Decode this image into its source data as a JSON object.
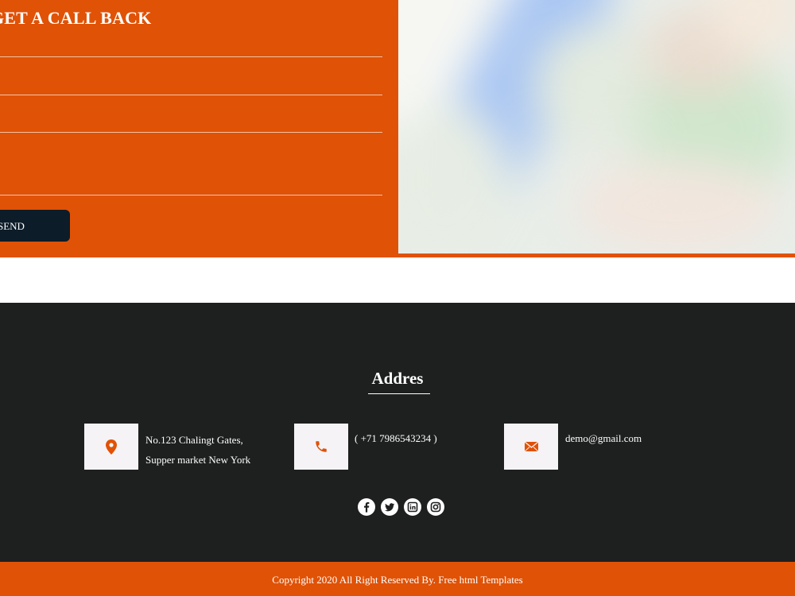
{
  "contact": {
    "title": "GET A CALL BACK",
    "fields": [
      {
        "placeholder": ""
      },
      {
        "placeholder": ""
      },
      {
        "placeholder": ""
      }
    ],
    "message_placeholder": "",
    "send_label": "SEND",
    "accent_color": "#e05206",
    "button_color": "#0c1c28"
  },
  "footer": {
    "title": "Addres",
    "address_line1": "No.123 Chalingt Gates,",
    "address_line2": "Supper market New York",
    "phone": "( +71 7986543234 )",
    "email": "demo@gmail.com",
    "icons": [
      "location-pin-icon",
      "phone-icon",
      "mail-icon"
    ],
    "socials": [
      "facebook-icon",
      "twitter-icon",
      "linkedin-icon",
      "instagram-icon"
    ],
    "background_color": "#1e1f1f"
  },
  "copyright": "Copyright 2020 All Right Reserved By. Free html Templates"
}
